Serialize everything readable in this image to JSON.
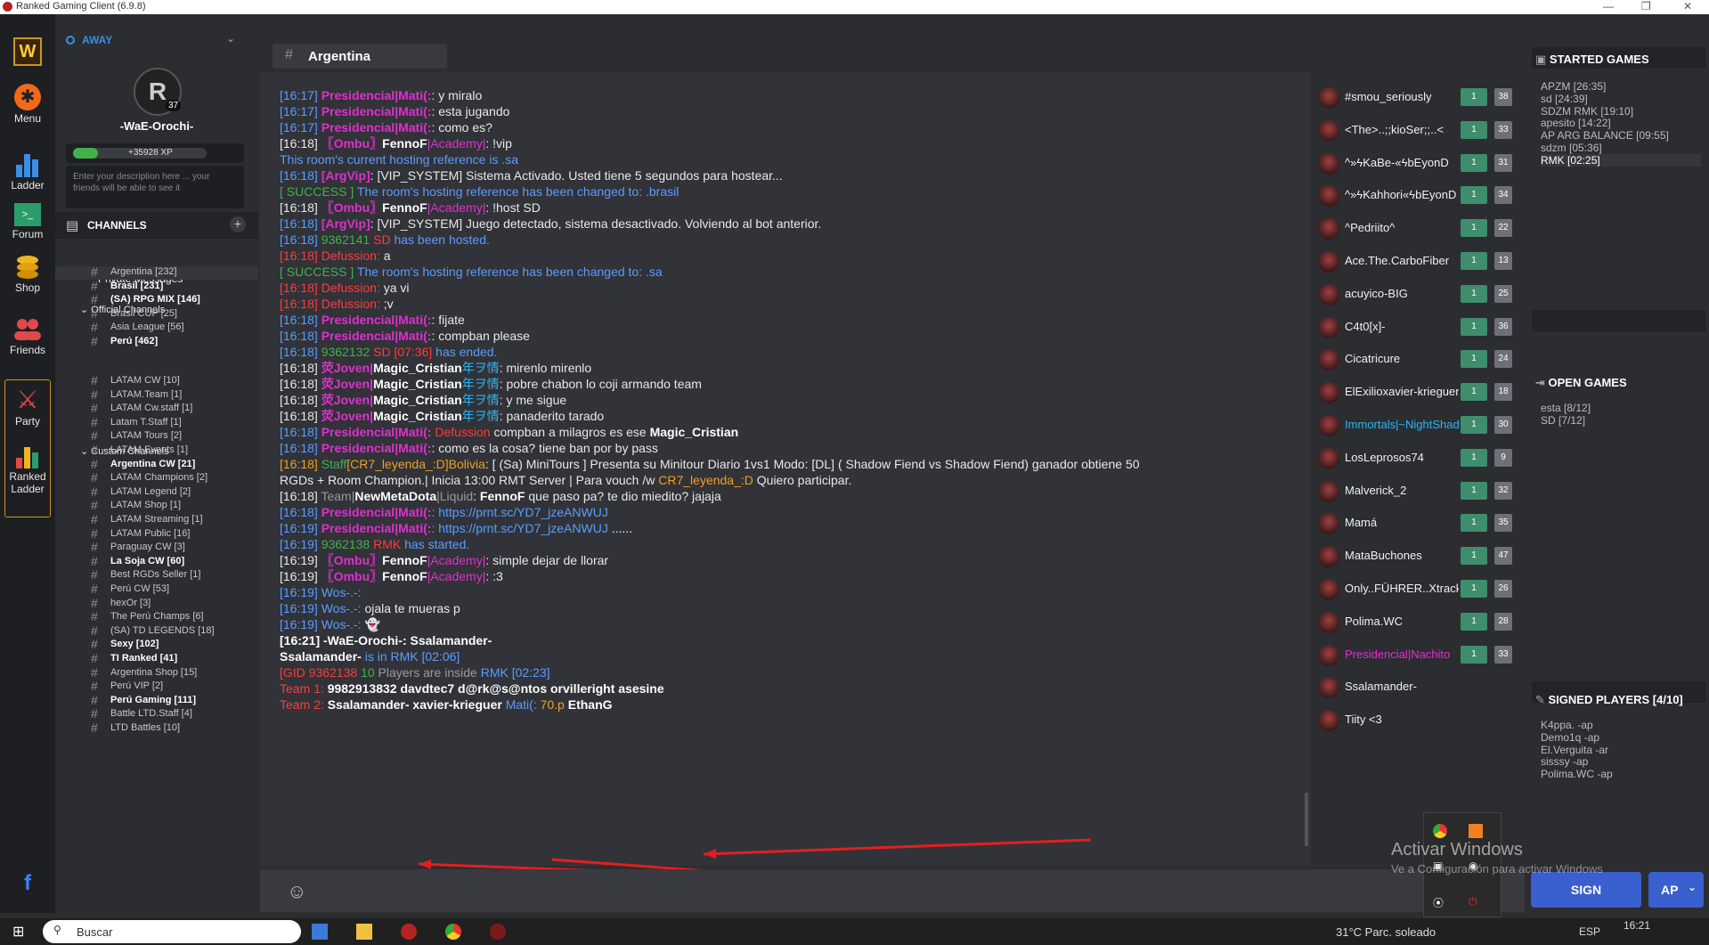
{
  "titlebar": {
    "title": "Ranked Gaming Client (6.9.8)"
  },
  "nav": {
    "menu": "Menu",
    "ladder": "Ladder",
    "forum": "Forum",
    "shop": "Shop",
    "friends": "Friends",
    "party": "Party",
    "ranked_ladder_1": "Ranked",
    "ranked_ladder_2": "Ladder"
  },
  "profile": {
    "status": "AWAY",
    "level": "37",
    "name": "-WaE-Orochi-",
    "xp": "+35928 XP",
    "desc": "Enter your description here ... your friends will be able to see it"
  },
  "sidebar": {
    "channels_label": "CHANNELS",
    "private": "Private Messages",
    "official_label": "Official Channels",
    "custom_label": "Custom Channels",
    "official": [
      {
        "name": "Argentina [232]",
        "bold": false
      },
      {
        "name": "Brasil [231]",
        "bold": true
      },
      {
        "name": "(SA) RPG MIX [146]",
        "bold": true
      },
      {
        "name": "Brasil CUP [25]",
        "bold": false
      },
      {
        "name": "Asia League [56]",
        "bold": false
      },
      {
        "name": "Perú [462]",
        "bold": true
      }
    ],
    "custom": [
      {
        "name": "LATAM CW [10]",
        "bold": false
      },
      {
        "name": "LATAM.Team [1]",
        "bold": false
      },
      {
        "name": "LATAM Cw.staff [1]",
        "bold": false
      },
      {
        "name": "Latam T.Staff [1]",
        "bold": false
      },
      {
        "name": "LATAM Tours [2]",
        "bold": false
      },
      {
        "name": "LATAM Events [1]",
        "bold": false
      },
      {
        "name": "Argentina CW [21]",
        "bold": true
      },
      {
        "name": "LATAM Champions [2]",
        "bold": false
      },
      {
        "name": "LATAM Legend [2]",
        "bold": false
      },
      {
        "name": "LATAM Shop [1]",
        "bold": false
      },
      {
        "name": "LATAM Streaming [1]",
        "bold": false
      },
      {
        "name": "LATAM Public [16]",
        "bold": false
      },
      {
        "name": "Paraguay CW [3]",
        "bold": false
      },
      {
        "name": "La Soja CW [60]",
        "bold": true
      },
      {
        "name": "Best RGDs Seller [1]",
        "bold": false
      },
      {
        "name": "Perú CW [53]",
        "bold": false
      },
      {
        "name": "hexOr [3]",
        "bold": false
      },
      {
        "name": "The Perú Champs [6]",
        "bold": false
      },
      {
        "name": "(SA) TD LEGENDS [18]",
        "bold": false
      },
      {
        "name": "Sexy [102]",
        "bold": true
      },
      {
        "name": "TI Ranked [41]",
        "bold": true
      },
      {
        "name": "Argentina Shop [15]",
        "bold": false
      },
      {
        "name": "Perú VIP [2]",
        "bold": false
      },
      {
        "name": "Perú Gaming [111]",
        "bold": true
      },
      {
        "name": "Battle LTD.Staff [4]",
        "bold": false
      },
      {
        "name": "LTD Battles [10]",
        "bold": false
      }
    ]
  },
  "chat": {
    "channel": "Argentina"
  },
  "messages": [
    [
      [
        "[16:17] ",
        "blue"
      ],
      [
        "Presidencial|Mati(:",
        "pink b"
      ],
      [
        ": y miralo",
        ""
      ]
    ],
    [
      [
        "[16:17] ",
        "blue"
      ],
      [
        "Presidencial|Mati(:",
        "pink b"
      ],
      [
        ": esta jugando",
        ""
      ]
    ],
    [
      [
        "[16:17] ",
        "blue"
      ],
      [
        "Presidencial|Mati(:",
        "pink b"
      ],
      [
        ": como es?",
        ""
      ]
    ],
    [
      [
        "[16:18] ",
        ""
      ],
      [
        "〖Ombu〗",
        "pink b"
      ],
      [
        "FennoF",
        "wht"
      ],
      [
        "|Academy|",
        "pink"
      ],
      [
        ": !vip",
        ""
      ]
    ],
    [
      [
        "This room's current hosting reference is .sa",
        "blue"
      ]
    ],
    [
      [
        "[16:18] ",
        "blue"
      ],
      [
        "[ArgVip]",
        "pink b"
      ],
      [
        ": [VIP_SYSTEM] Sistema Activado. Usted tiene 5 segundos para hostear...",
        ""
      ]
    ],
    [
      [
        "[ SUCCESS ] ",
        "green"
      ],
      [
        "The room's hosting reference has been changed to: .brasil",
        "blue"
      ]
    ],
    [
      [
        "[16:18] ",
        ""
      ],
      [
        "〖Ombu〗",
        "pink b"
      ],
      [
        "FennoF",
        "wht"
      ],
      [
        "|Academy|",
        "pink"
      ],
      [
        ": !host SD",
        ""
      ]
    ],
    [
      [
        "[16:18] ",
        "blue"
      ],
      [
        "[ArgVip]",
        "pink b"
      ],
      [
        ": [VIP_SYSTEM] Juego detectado, sistema desactivado. Volviendo al bot anterior.",
        ""
      ]
    ],
    [
      [
        "[16:18] ",
        "blue"
      ],
      [
        "9362141 ",
        "green"
      ],
      [
        "SD ",
        "red"
      ],
      [
        "has been hosted.",
        "blue"
      ]
    ],
    [
      [
        "[16:18] Defussion:",
        "red"
      ],
      [
        " a",
        ""
      ]
    ],
    [
      [
        "[ SUCCESS ] ",
        "green"
      ],
      [
        "The room's hosting reference has been changed to: .sa",
        "blue"
      ]
    ],
    [
      [
        "[16:18] Defussion:",
        "red"
      ],
      [
        " ya vi",
        ""
      ]
    ],
    [
      [
        "[16:18] Defussion:",
        "red"
      ],
      [
        " ;v",
        ""
      ]
    ],
    [
      [
        "[16:18] ",
        "blue"
      ],
      [
        "Presidencial|Mati(:",
        "pink b"
      ],
      [
        ": fijate",
        ""
      ]
    ],
    [
      [
        "[16:18] ",
        "blue"
      ],
      [
        "Presidencial|Mati(:",
        "pink b"
      ],
      [
        ": compban please",
        ""
      ]
    ],
    [
      [
        "[16:18] ",
        "blue"
      ],
      [
        "9362132 ",
        "green"
      ],
      [
        "SD [07:36] ",
        "red"
      ],
      [
        "has ended.",
        "blue"
      ]
    ],
    [
      [
        "[16:18] ",
        ""
      ],
      [
        "荧Joven|",
        "pink b"
      ],
      [
        "Magic_Cristian",
        "wht"
      ],
      [
        "年ヲ情",
        "cyan"
      ],
      [
        ": mirenlo mirenlo",
        ""
      ]
    ],
    [
      [
        "[16:18] ",
        ""
      ],
      [
        "荧Joven|",
        "pink b"
      ],
      [
        "Magic_Cristian",
        "wht"
      ],
      [
        "年ヲ情",
        "cyan"
      ],
      [
        ": pobre chabon lo coji armando team",
        ""
      ]
    ],
    [
      [
        "[16:18] ",
        ""
      ],
      [
        "荧Joven|",
        "pink b"
      ],
      [
        "Magic_Cristian",
        "wht"
      ],
      [
        "年ヲ情",
        "cyan"
      ],
      [
        ": y me sigue",
        ""
      ]
    ],
    [
      [
        "[16:18] ",
        ""
      ],
      [
        "荧Joven|",
        "pink b"
      ],
      [
        "Magic_Cristian",
        "wht"
      ],
      [
        "年ヲ情",
        "cyan"
      ],
      [
        ": panaderito tarado",
        ""
      ]
    ],
    [
      [
        "[16:18] ",
        "blue"
      ],
      [
        "Presidencial|Mati(:",
        "pink b"
      ],
      [
        " ",
        ""
      ],
      [
        "Defussion",
        "red"
      ],
      [
        " compban a milagros es ese ",
        ""
      ],
      [
        "Magic_Cristian",
        "wht"
      ]
    ],
    [
      [
        "[16:18] ",
        "blue"
      ],
      [
        "Presidencial|Mati(:",
        "pink b"
      ],
      [
        ": como es la cosa? tiene ban por by pass",
        ""
      ]
    ],
    [
      [
        "[16:18] ",
        "orange"
      ],
      [
        "Staff",
        "green"
      ],
      [
        "[CR7_leyenda_:D]",
        "orange"
      ],
      [
        "Bolivia",
        "orange"
      ],
      [
        ": [ (Sa) MiniTours ] Presenta su Minitour Diario 1vs1 Modo: [DL] ( Shadow Fiend vs Shadow Fiend) ganador obtiene 50",
        ""
      ]
    ],
    [
      [
        "RGDs + Room Champion.| Inicia 13:00 RMT Server | Para vouch /w ",
        ""
      ],
      [
        "CR7_leyenda_:D",
        "orange"
      ],
      [
        " Quiero participar.",
        ""
      ]
    ],
    [
      [
        "[16:18] ",
        ""
      ],
      [
        "Team|",
        "gray"
      ],
      [
        "NewMetaDota",
        "wht"
      ],
      [
        "|Liquid",
        "gray"
      ],
      [
        ": ",
        ""
      ],
      [
        "FennoF",
        "wht"
      ],
      [
        " que paso pa? te dio miedito? jajaja",
        ""
      ]
    ],
    [
      [
        "[16:18] ",
        "blue"
      ],
      [
        "Presidencial|Mati(:",
        "pink b"
      ],
      [
        ": https://prnt.sc/YD7_jzeANWUJ",
        "blue"
      ]
    ],
    [
      [
        "[16:19] ",
        "blue"
      ],
      [
        "Presidencial|Mati(:",
        "pink b"
      ],
      [
        ": https://prnt.sc/YD7_jzeANWUJ ",
        "blue"
      ],
      [
        "......",
        ""
      ]
    ],
    [
      [
        "[16:19] ",
        "blue"
      ],
      [
        "9362138 ",
        "green"
      ],
      [
        "RMK ",
        "red"
      ],
      [
        "has started.",
        "blue"
      ]
    ],
    [
      [
        "[16:19] ",
        ""
      ],
      [
        "〖Ombu〗",
        "pink b"
      ],
      [
        "FennoF",
        "wht"
      ],
      [
        "|Academy|",
        "pink"
      ],
      [
        ": simple dejar de llorar",
        ""
      ]
    ],
    [
      [
        "[16:19] ",
        ""
      ],
      [
        "〖Ombu〗",
        "pink b"
      ],
      [
        "FennoF",
        "wht"
      ],
      [
        "|Academy|",
        "pink"
      ],
      [
        ": :3",
        ""
      ]
    ],
    [
      [
        "[16:19] Wos-.-:",
        "blue"
      ]
    ],
    [
      [
        "[16:19] Wos-.-:",
        "blue"
      ],
      [
        " ojala te mueras p",
        ""
      ]
    ],
    [
      [
        "[16:19] Wos-.-:",
        "blue"
      ],
      [
        " 👻",
        ""
      ]
    ],
    [
      [
        "[16:21] -WaE-Orochi-: Ssalamander-",
        "wht"
      ]
    ],
    [
      [
        "Ssalamander-",
        "wht"
      ],
      [
        " is in RMK [02:06]",
        "blue"
      ]
    ],
    [
      [
        "[GID 9362138 ",
        "red"
      ],
      [
        "10 ",
        "green"
      ],
      [
        "Players are inside ",
        "gray"
      ],
      [
        "RMK [02:23]",
        "blue"
      ]
    ],
    [
      [
        "Team 1:  ",
        "red"
      ],
      [
        "9982913832   davdtec7   d@rk@s@ntos   orvilleright   asesine",
        "wht"
      ]
    ],
    [
      [
        "Team 2:  ",
        "red"
      ],
      [
        "Ssalamander-   xavier-krieguer   ",
        "wht"
      ],
      [
        "Mati(:",
        "blue"
      ],
      [
        "   70.p   ",
        "orange"
      ],
      [
        "EthanG",
        "wht"
      ]
    ]
  ],
  "users": [
    {
      "name": "#smou_seriously",
      "a": "1",
      "b": "38"
    },
    {
      "name": "<The>..;;kioSer;;..<",
      "a": "1",
      "b": "33"
    },
    {
      "name": "^»ϟKaBe-«ϟbEyonD",
      "a": "1",
      "b": "31"
    },
    {
      "name": "^»ϟKahhori«ϟbEyonD",
      "a": "1",
      "b": "34"
    },
    {
      "name": "^Pedriito^",
      "a": "1",
      "b": "22"
    },
    {
      "name": "Ace.The.CarboFiber",
      "a": "1",
      "b": "13"
    },
    {
      "name": "acuyico-BIG",
      "a": "1",
      "b": "25"
    },
    {
      "name": "C4t0[x]-",
      "a": "1",
      "b": "36"
    },
    {
      "name": "Cicatricure",
      "a": "1",
      "b": "24"
    },
    {
      "name": "ElExilioxavier-krieguer",
      "a": "1",
      "b": "18"
    },
    {
      "name": "Immortals|~NightShade",
      "a": "1",
      "b": "30"
    },
    {
      "name": "LosLeprosos74",
      "a": "1",
      "b": "9"
    },
    {
      "name": "Malverick_2",
      "a": "1",
      "b": "32"
    },
    {
      "name": "Mamá",
      "a": "1",
      "b": "35"
    },
    {
      "name": "MataBuchones",
      "a": "1",
      "b": "47"
    },
    {
      "name": "Only..FÜHRER..Xtrack",
      "a": "1",
      "b": "26"
    },
    {
      "name": "Polima.WC",
      "a": "1",
      "b": "28"
    },
    {
      "name": "Presidencial|Nachito",
      "a": "1",
      "b": "33"
    },
    {
      "name": "Ssalamander-",
      "a": "",
      "b": ""
    },
    {
      "name": "Tiity <3",
      "a": "",
      "b": ""
    }
  ],
  "right": {
    "started_label": "STARTED GAMES",
    "started": [
      "APZM [26:35]",
      "sd [24:39]",
      "SDZM RMK [19:10]",
      "apesito [14:22]",
      "AP ARG BALANCE [09:55]",
      "sdzm [05:36]",
      "RMK [02:25]"
    ],
    "open_label": "OPEN GAMES",
    "open": [
      "esta [8/12]",
      "SD [7/12]"
    ],
    "signed_label": "SIGNED PLAYERS [4/10]",
    "signed": [
      "K4ppa. -ap",
      "Demo1q -ap",
      "El.Verguita -ar",
      "sisssy -ap",
      "Polima.WC -ap"
    ],
    "sign_btn": "SIGN",
    "mode_btn": "AP"
  },
  "watermark": {
    "line1": "Activar Windows",
    "line2": "Ve a Configuración para activar Windows"
  },
  "taskbar": {
    "search": "Buscar",
    "weather": "31°C  Parc. soleado",
    "lang": "ESP",
    "time": "16:21"
  }
}
